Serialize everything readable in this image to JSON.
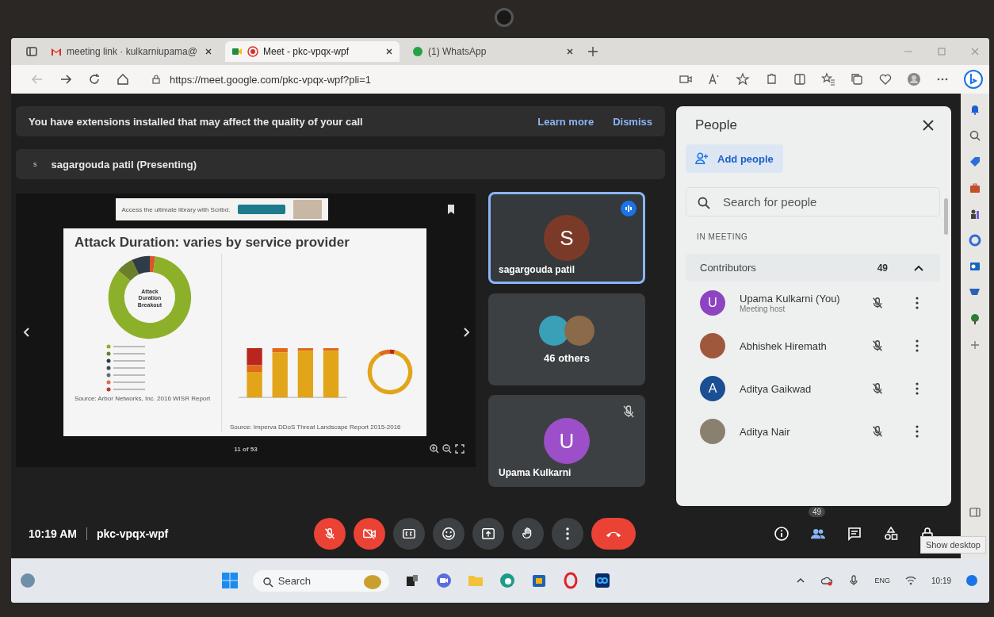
{
  "browser": {
    "tabs": [
      {
        "title": "meeting link · kulkarniupama@",
        "kind": "mail",
        "selected": false
      },
      {
        "title": "Meet - pkc-vpqx-wpf",
        "kind": "meet",
        "selected": true
      },
      {
        "title": "(1) WhatsApp",
        "kind": "whatsapp",
        "selected": false
      }
    ],
    "url": "https://meet.google.com/pkc-vpqx-wpf?pli=1"
  },
  "banner": {
    "message": "You have extensions installed that may affect the quality of your call",
    "links": [
      "Learn more",
      "Dismiss"
    ]
  },
  "presenter_bar": {
    "initial": "s",
    "label": "sagargouda patil (Presenting)"
  },
  "presentation": {
    "ad_text": "Access the ultimate library with Scribd.",
    "slide_title": "Attack Duration: varies by service provider",
    "donut_label": "Attack Duration Breakout",
    "source_left": "Source:  Arbor Networks, Inc. 2016 WISR Report",
    "source_right": "Source:  Imperva DDoS Threat Landscape Report 2015-2016",
    "page": "11 of 53"
  },
  "tiles": [
    {
      "kind": "person",
      "name": "sagargouda patil",
      "initial": "S",
      "color": "#7b3a28",
      "speaking": true,
      "muted": false
    },
    {
      "kind": "group",
      "label": "46 others"
    },
    {
      "kind": "person",
      "name": "Upama Kulkarni",
      "initial": "U",
      "color": "#9c4fc8",
      "speaking": false,
      "muted": true
    }
  ],
  "people": {
    "title": "People",
    "add_label": "Add people",
    "search_placeholder": "Search for people",
    "section": "IN MEETING",
    "group": {
      "label": "Contributors",
      "count": "49",
      "expanded": true
    },
    "members": [
      {
        "name": "Upama Kulkarni (You)",
        "subtitle": "Meeting host",
        "kind": "initial",
        "initial": "U",
        "color": "#8e44c0"
      },
      {
        "name": "Abhishek Hiremath",
        "kind": "photo",
        "color": "#a0583c"
      },
      {
        "name": "Aditya Gaikwad",
        "kind": "initial",
        "initial": "A",
        "color": "#1a4f94"
      },
      {
        "name": "Aditya Nair",
        "kind": "photo",
        "color": "#8a8070"
      }
    ]
  },
  "bottom_bar": {
    "time": "10:19 AM",
    "code": "pkc-vpqx-wpf",
    "people_count": "49",
    "controls": [
      {
        "kind": "mic",
        "on": false
      },
      {
        "kind": "camera",
        "on": false
      },
      {
        "kind": "captions"
      },
      {
        "kind": "emoji"
      },
      {
        "kind": "present"
      },
      {
        "kind": "hand"
      },
      {
        "kind": "more"
      },
      {
        "kind": "leave"
      }
    ]
  },
  "taskbar": {
    "search_placeholder": "Search",
    "language": "ENG",
    "clock": "10:19",
    "tooltip": "Show desktop"
  }
}
